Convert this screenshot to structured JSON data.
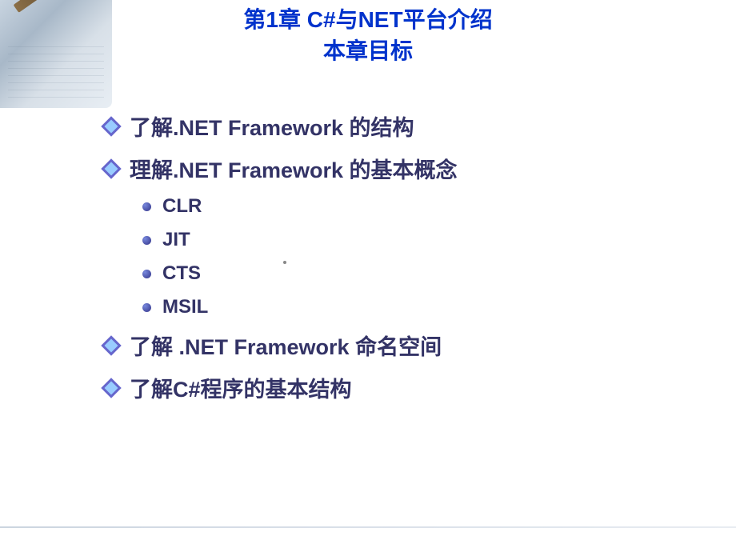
{
  "header": {
    "title_line1": "第1章  C#与NET平台介绍",
    "title_line2": "本章目标"
  },
  "bullets": {
    "item1": "了解.NET Framework 的结构",
    "item2": "理解.NET Framework 的基本概念",
    "sub1": "CLR",
    "sub2": "JIT",
    "sub3": "CTS",
    "sub4": "MSIL",
    "item3": "了解 .NET Framework 命名空间",
    "item4": "了解C#程序的基本结构"
  }
}
